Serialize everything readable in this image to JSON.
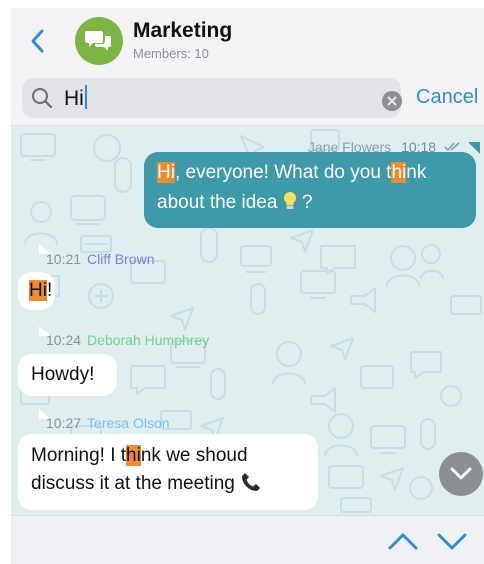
{
  "header": {
    "title": "Marketing",
    "subtitle": "Members: 10",
    "avatar_color": "#7cb542",
    "back_icon": "chevron-left-icon",
    "avatar_icon": "chat-bubbles-icon"
  },
  "search": {
    "query": "Hi",
    "cancel_label": "Cancel",
    "search_icon": "magnifier-icon",
    "clear_icon": "clear-circle-icon"
  },
  "messages": [
    {
      "direction": "outgoing",
      "sender": "Jane Flowers",
      "time": "10:18",
      "status": "read",
      "parts": [
        "",
        "Hi",
        ", everyone! What do you t",
        "hi",
        "nk",
        "about the idea",
        "?"
      ],
      "emoji": "lightbulb"
    },
    {
      "direction": "incoming",
      "sender": "Cliff Brown",
      "sender_color": "#7b7fd6",
      "time": "10:21",
      "parts": [
        "Hi",
        "!"
      ]
    },
    {
      "direction": "incoming",
      "sender": "Deborah Humphrey",
      "sender_color": "#6fd28f",
      "time": "10:24",
      "text": "Howdy!"
    },
    {
      "direction": "incoming",
      "sender": "Teresa Olson",
      "sender_color": "#7bc3e6",
      "time": "10:27",
      "parts": [
        "Morning! I t",
        "hi",
        "nk we shoud",
        "discuss it at the meeting"
      ],
      "emoji": "telephone"
    }
  ],
  "colors": {
    "accent": "#2e8fd0",
    "outgoing_bubble": "#3e99a8",
    "highlight": "#ee8b2e",
    "chat_background": "#e1eef0"
  },
  "controls": {
    "scroll_down_icon": "chevron-down-icon",
    "prev_result_icon": "chevron-up-icon",
    "next_result_icon": "chevron-down-icon"
  }
}
